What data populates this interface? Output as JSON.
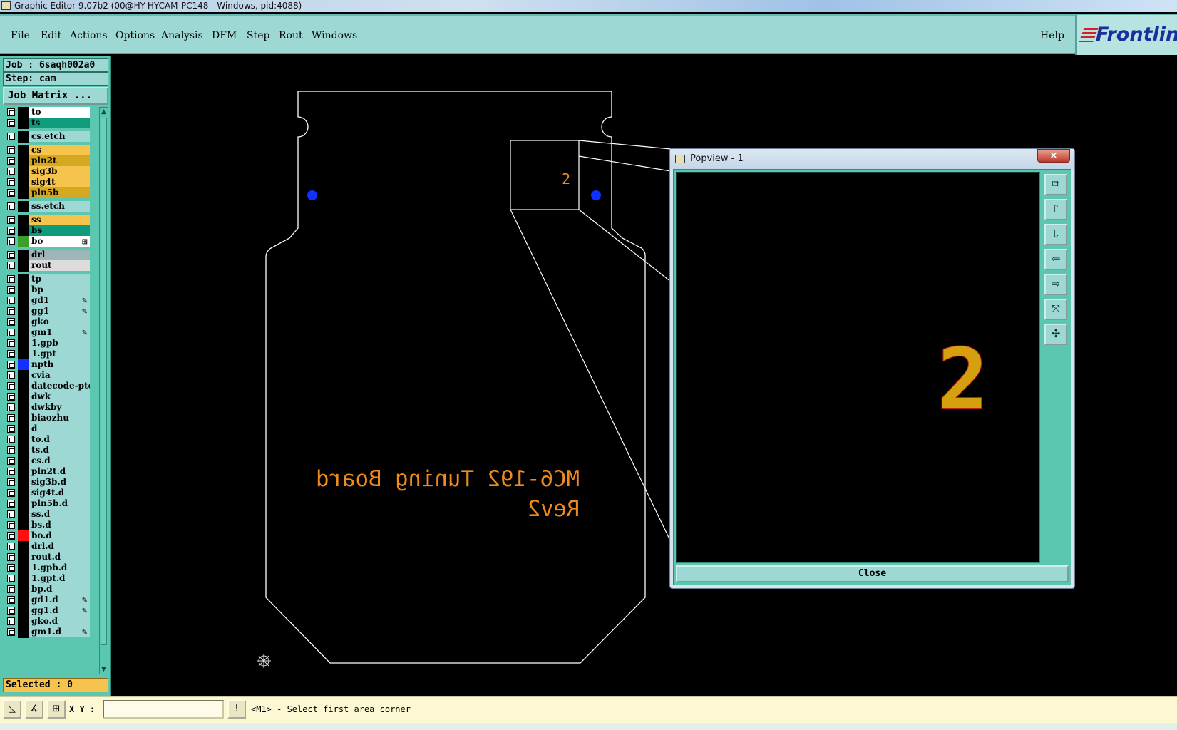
{
  "window": {
    "title": "Graphic Editor 9.07b2 (00@HY-HYCAM-PC148 - Windows, pid:4088)"
  },
  "menu": {
    "items": [
      "File",
      "Edit",
      "Actions",
      "Options",
      "Analysis",
      "DFM",
      "Step",
      "Rout",
      "Windows"
    ],
    "help": "Help",
    "brand": "Frontline"
  },
  "job": {
    "job_label": "Job : 6saqh002a0",
    "step_label": "Step: cam",
    "matrix_button": "Job Matrix ..."
  },
  "layers": [
    {
      "name": "to",
      "color": "#ffffff",
      "swatch": "#000000",
      "flag": ""
    },
    {
      "name": "ts",
      "color": "#0f9c7c",
      "swatch": "#000000",
      "flag": ""
    },
    {
      "name": "cs.etch",
      "color": "#9ed8d4",
      "swatch": "#000000",
      "flag": ""
    },
    {
      "name": "cs",
      "color": "#f6c44c",
      "swatch": "#000000",
      "flag": ""
    },
    {
      "name": "pln2t",
      "color": "#d4a820",
      "swatch": "#000000",
      "flag": ""
    },
    {
      "name": "sig3b",
      "color": "#f6c44c",
      "swatch": "#000000",
      "flag": ""
    },
    {
      "name": "sig4t",
      "color": "#f6c44c",
      "swatch": "#000000",
      "flag": ""
    },
    {
      "name": "pln5b",
      "color": "#d4a820",
      "swatch": "#000000",
      "flag": ""
    },
    {
      "name": "ss.etch",
      "color": "#9ed8d4",
      "swatch": "#000000",
      "flag": ""
    },
    {
      "name": "ss",
      "color": "#f6c44c",
      "swatch": "#000000",
      "flag": ""
    },
    {
      "name": "bs",
      "color": "#0f9c7c",
      "swatch": "#000000",
      "flag": ""
    },
    {
      "name": "bo",
      "color": "#ffffff",
      "swatch": "#3aa02a",
      "flag": "⊞"
    },
    {
      "name": "drl",
      "color": "#9fb6b8",
      "swatch": "#000000",
      "flag": ""
    },
    {
      "name": "rout",
      "color": "#dcdcdc",
      "swatch": "#000000",
      "flag": ""
    },
    {
      "name": "tp",
      "color": "#9ed8d4",
      "swatch": "#000000",
      "flag": ""
    },
    {
      "name": "bp",
      "color": "#9ed8d4",
      "swatch": "#000000",
      "flag": ""
    },
    {
      "name": "gd1",
      "color": "#9ed8d4",
      "swatch": "#000000",
      "flag": "✎"
    },
    {
      "name": "gg1",
      "color": "#9ed8d4",
      "swatch": "#000000",
      "flag": "✎"
    },
    {
      "name": "gko",
      "color": "#9ed8d4",
      "swatch": "#000000",
      "flag": ""
    },
    {
      "name": "gm1",
      "color": "#9ed8d4",
      "swatch": "#000000",
      "flag": "✎"
    },
    {
      "name": "1.gpb",
      "color": "#9ed8d4",
      "swatch": "#000000",
      "flag": ""
    },
    {
      "name": "1.gpt",
      "color": "#9ed8d4",
      "swatch": "#000000",
      "flag": ""
    },
    {
      "name": "npth",
      "color": "#9ed8d4",
      "swatch": "#1030ff",
      "flag": ""
    },
    {
      "name": "cvia",
      "color": "#9ed8d4",
      "swatch": "#000000",
      "flag": ""
    },
    {
      "name": "datecode-pte",
      "color": "#9ed8d4",
      "swatch": "#000000",
      "flag": ""
    },
    {
      "name": "dwk",
      "color": "#9ed8d4",
      "swatch": "#000000",
      "flag": ""
    },
    {
      "name": "dwkby",
      "color": "#9ed8d4",
      "swatch": "#000000",
      "flag": ""
    },
    {
      "name": "biaozhu",
      "color": "#9ed8d4",
      "swatch": "#000000",
      "flag": ""
    },
    {
      "name": "d",
      "color": "#9ed8d4",
      "swatch": "#000000",
      "flag": ""
    },
    {
      "name": "to.d",
      "color": "#9ed8d4",
      "swatch": "#000000",
      "flag": ""
    },
    {
      "name": "ts.d",
      "color": "#9ed8d4",
      "swatch": "#000000",
      "flag": ""
    },
    {
      "name": "cs.d",
      "color": "#9ed8d4",
      "swatch": "#000000",
      "flag": ""
    },
    {
      "name": "pln2t.d",
      "color": "#9ed8d4",
      "swatch": "#000000",
      "flag": ""
    },
    {
      "name": "sig3b.d",
      "color": "#9ed8d4",
      "swatch": "#000000",
      "flag": ""
    },
    {
      "name": "sig4t.d",
      "color": "#9ed8d4",
      "swatch": "#000000",
      "flag": ""
    },
    {
      "name": "pln5b.d",
      "color": "#9ed8d4",
      "swatch": "#000000",
      "flag": ""
    },
    {
      "name": "ss.d",
      "color": "#9ed8d4",
      "swatch": "#000000",
      "flag": ""
    },
    {
      "name": "bs.d",
      "color": "#9ed8d4",
      "swatch": "#000000",
      "flag": ""
    },
    {
      "name": "bo.d",
      "color": "#9ed8d4",
      "swatch": "#ff1010",
      "flag": ""
    },
    {
      "name": "drl.d",
      "color": "#9ed8d4",
      "swatch": "#000000",
      "flag": ""
    },
    {
      "name": "rout.d",
      "color": "#9ed8d4",
      "swatch": "#000000",
      "flag": ""
    },
    {
      "name": "1.gpb.d",
      "color": "#9ed8d4",
      "swatch": "#000000",
      "flag": ""
    },
    {
      "name": "1.gpt.d",
      "color": "#9ed8d4",
      "swatch": "#000000",
      "flag": ""
    },
    {
      "name": "bp.d",
      "color": "#9ed8d4",
      "swatch": "#000000",
      "flag": ""
    },
    {
      "name": "gd1.d",
      "color": "#9ed8d4",
      "swatch": "#000000",
      "flag": "✎"
    },
    {
      "name": "gg1.d",
      "color": "#9ed8d4",
      "swatch": "#000000",
      "flag": "✎"
    },
    {
      "name": "gko.d",
      "color": "#9ed8d4",
      "swatch": "#000000",
      "flag": ""
    },
    {
      "name": "gm1.d",
      "color": "#9ed8d4",
      "swatch": "#000000",
      "flag": "✎"
    }
  ],
  "selected_label": "Selected : 0",
  "board": {
    "silk_line1": "MC6-192 Tuning Board",
    "silk_line2": "Rev2",
    "zoom_label": "2",
    "outline_color": "#ffffff",
    "silk_color": "#f08a1c",
    "drill_color": "#1030ff"
  },
  "popview": {
    "title": "Popview - 1",
    "close_x": "×",
    "magnified_label": "2",
    "close_button": "Close",
    "tools": [
      "zoom-home-icon",
      "pan-up-icon",
      "pan-down-icon",
      "pan-left-icon",
      "pan-right-icon",
      "zoom-in-icon",
      "zoom-out-icon"
    ],
    "label_color": "#d4a010",
    "label_outline": "#c02010"
  },
  "status": {
    "xy_label": "X Y :",
    "xy_value": "",
    "bang": "!",
    "prompt": "<M1> - Select first area corner"
  }
}
